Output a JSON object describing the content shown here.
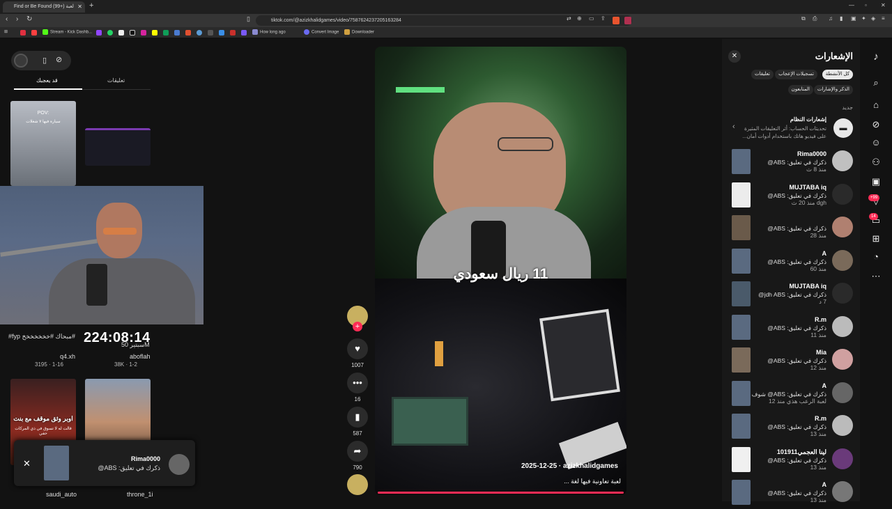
{
  "browser": {
    "tab_title": "Find or Be Found لعبة (+99)",
    "new_tab": "+",
    "url": "tiktok.com/@azizkhalidgames/video/7587624237205163284",
    "bookmarks": [
      "Stream - Kick Dashb...",
      "How long ago",
      "Convert Image",
      "Downloader"
    ]
  },
  "left": {
    "tab_comments": "تعليقات",
    "tab_likes": "قد يعجبك",
    "timer": "224:08:14",
    "cards": [
      {
        "title": "#مبحاك #خخخخخخخ fyp#",
        "user": "q4.xh",
        "stats": "3195 · 1-16"
      },
      {
        "title": "سبتير 50M",
        "user": "aboflah",
        "stats": "38K · 1-2"
      },
      {
        "title": "اوبر وثق موقف مع بنت",
        "subtitle": "قالت له لا تسوق في ذي المركات حفي",
        "user": "saudi_auto"
      },
      {
        "title": "",
        "user": "throne_1i"
      }
    ],
    "thumb_pov": "POV:",
    "thumb_pov2": "سيارة فيها ٧ شغلات",
    "toast": {
      "name": "Rima0000",
      "text": "ذكرك في تعليق: ABS@"
    }
  },
  "video": {
    "caption": "11 ريال سعودي",
    "author": "azizkhalidgames",
    "date": "2025-12-25",
    "description": "لعبة تعاونية فيها لغة ...",
    "likes": "1007",
    "comments": "16",
    "saves": "587",
    "shares": "790"
  },
  "notifications": {
    "title": "الإشعارات",
    "chips_row1": [
      "كل الأنشطة",
      "تسجيلات الإعجاب",
      "تعليقات"
    ],
    "chips_row2": [
      "الذكر والإشارات",
      "المتابعون"
    ],
    "section_new": "جديد",
    "system": {
      "title": "إشعارات النظام",
      "line1": "تحديثات الحساب: أثر التعليقات المثيرة",
      "line2": "على فيديو هاتك باستخدام أدوات أمان..."
    },
    "items": [
      {
        "name": "Rima0000",
        "body": "ذكرك في تعليق: ABS@",
        "time": "منذ 8 ث"
      },
      {
        "name": "MUJTABA iq",
        "body": "ذكرك في تعليق: ABS@",
        "time": "dgh منذ 20 ث"
      },
      {
        "name": "",
        "body": "ذكرك في تعليق: ABS@",
        "time": "منذ 28"
      },
      {
        "name": "A",
        "body": "ذكرك في تعليق: ABS@",
        "time": "منذ 60"
      },
      {
        "name": "MUJTABA iq",
        "body": "ذكرك في تعليق: jdh ABS@",
        "time": "7 د"
      },
      {
        "name": "R.m",
        "body": "ذكرك في تعليق: ABS@",
        "time": "منذ 11"
      },
      {
        "name": "Mia",
        "body": "ذكرك في تعليق: ABS@",
        "time": "منذ 12"
      },
      {
        "name": "A",
        "body": "ذكرك في تعليق: ABS@ شوف",
        "time": "لعبة الرعب هذي منذ 12"
      },
      {
        "name": "R.m",
        "body": "ذكرك في تعليق: ABS@",
        "time": "منذ 13"
      },
      {
        "name": "101لينا العجمي911",
        "body": "ذكرك في تعليق: ABS@",
        "time": "منذ 13"
      },
      {
        "name": "A",
        "body": "ذكرك في تعليق: ABS@",
        "time": "منذ 13"
      }
    ],
    "badges": {
      "inbox": "+99",
      "messages": "14"
    }
  }
}
